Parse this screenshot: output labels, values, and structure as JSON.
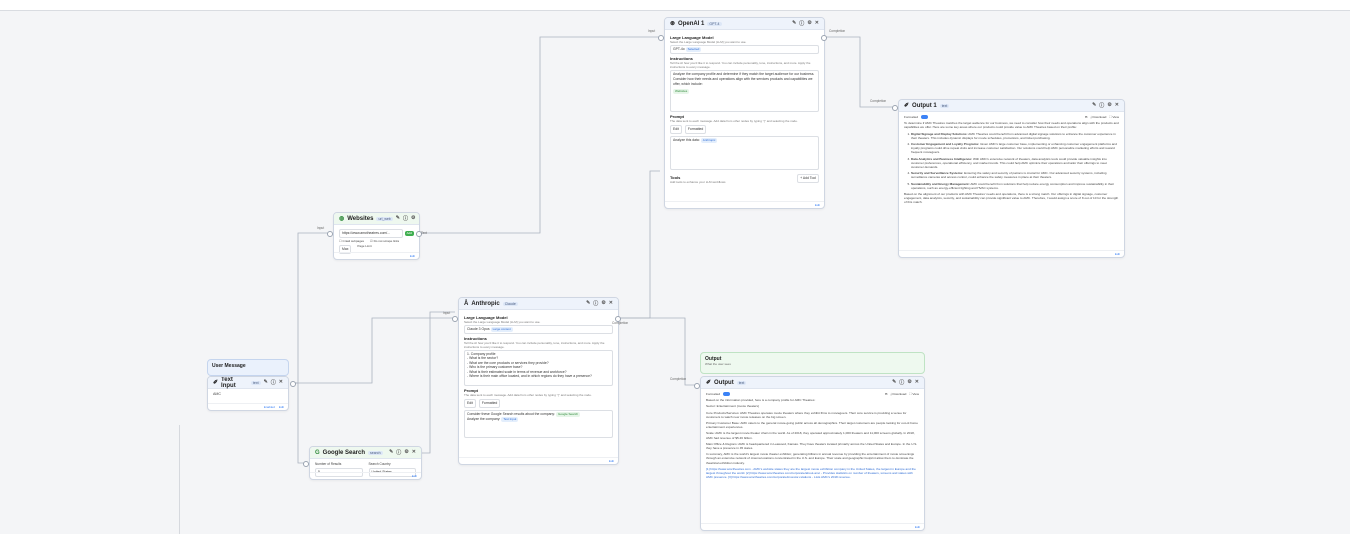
{
  "openai": {
    "title": "OpenAI 1",
    "badge": "GPT-4",
    "llm_label": "Large Language Model",
    "llm_sub": "Select the Large Language Model (LLM) you want to use.",
    "model": "GPT-4o",
    "model_chip": "Selected",
    "instr_label": "Instructions",
    "instr_sub": "Tell the AI how you'd like it to respond. You can include personality, tone, instructions, and more. Apply the instructions to every message.",
    "instr_text": "Analyze the company profile and determine if they match the target audience for our business. Consider how their needs and operations align with the services products and capabilities we offer, which include:",
    "instr_chip": "Websites",
    "prompt_label": "Prompt",
    "prompt_sub": "The data sent to each message. Add data from other nodes by typing \"{\" and selecting the node.",
    "prompt_tabs": [
      "Edit",
      "Formatted"
    ],
    "prompt_text": "Analyze this data:",
    "prompt_chip": "Anthropic",
    "tools_label": "Tools",
    "tools_sub": "Add tools to enhance your LLM workflows",
    "add_tool": "+ Add Tool",
    "footer_left": "",
    "footer_right": "Edit",
    "in_label": "Input",
    "out_label": "Completion"
  },
  "output1": {
    "title": "Output 1",
    "badge": "text",
    "formatted": "Formatted",
    "download": "Download",
    "view": "View",
    "intro": "To determine if AMC Theatres matches the target audience for our business, we need to consider how their needs and operations align with the products and capabilities we offer. Here are some key areas where our products could provide value to AMC Theatres based on their profile:",
    "items": [
      {
        "head": "Digital Signage and Display Solutions:",
        "text": "AMC Theatres could benefit from advanced digital signage solutions to enhance the customer experience in their theaters. This includes dynamic displays for movie schedules, promotions, and ticket purchasing."
      },
      {
        "head": "Customer Engagement and Loyalty Programs:",
        "text": "Given AMC's large customer base, implementing or enhancing customer engagement platforms and loyalty programs could drive repeat visits and increase customer satisfaction. Our solutions could help AMC personalize marketing efforts and reward frequent moviegoers."
      },
      {
        "head": "Data Analytics and Business Intelligence:",
        "text": "With AMC's extensive network of theaters, data analytics tools could provide valuable insights into customer preferences, operational efficiency, and market trends. This could help AMC optimize their operations and tailor their offerings to meet customer demands."
      },
      {
        "head": "Security and Surveillance Systems:",
        "text": "Ensuring the safety and security of patrons is crucial for AMC. Our advanced security systems, including surveillance cameras and access control, could enhance the safety measures in place at their theaters."
      },
      {
        "head": "Sustainability and Energy Management:",
        "text": "AMC could benefit from solutions that help reduce energy consumption and improve sustainability in their operations, such as energy-efficient lighting and HVAC systems."
      }
    ],
    "outro": "Based on the alignment of our products with AMC Theatres' needs and operations, there is a strong match. Our offerings in digital signage, customer engagement, data analytics, security, and sustainability can provide significant value to AMC. Therefore, I would assign a score of 8 out of 10 for the strength of this match.",
    "footer_left": "",
    "footer_right": "Edit",
    "in_label": "Completion"
  },
  "websites": {
    "title": "Websites",
    "badge": "url_web",
    "url": "https://www.amctheatres.com/...",
    "add": "Add",
    "opt1": "Crawl subpages",
    "opt2": "Do not scrape links",
    "row_label": "Max",
    "row_value": "Page Limit",
    "footer_left": "",
    "footer_right": "Edit",
    "in_label": "Input",
    "out_label": "Text"
  },
  "anthropic": {
    "title": "Anthropic",
    "badge": "Claude",
    "llm_label": "Large Language Model",
    "llm_sub": "Select the Large Language Model (LLM) you want to use.",
    "model": "Claude 3 Opus",
    "model_chip": "Large context",
    "instr_label": "Instructions",
    "instr_sub": "Tell the AI how you'd like it to respond. You can include personality, tone, instructions, and more. Apply the instructions to every message.",
    "instr_lines": [
      "1. Company profile",
      "- What is the sector?",
      "- What are the core products or services they provide?",
      "- Who is the primary customer base?",
      "- What is their estimated scale in terms of revenue and workforce?",
      "- Where is their main office located, and in which regions do they have a presence?"
    ],
    "prompt_label": "Prompt",
    "prompt_sub": "The data sent to each message. Add data from other nodes by typing \"{\" and selecting the node.",
    "prompt_tabs": [
      "Edit",
      "Formatted"
    ],
    "prompt_line1": "Consider these Google Search results about the company:",
    "prompt_chip1": "Google Search",
    "prompt_line2": "Analyze the company:",
    "prompt_chip2": "Text Input",
    "footer_left": "",
    "footer_right": "Edit",
    "in_label": "Input",
    "out_label": "Completion"
  },
  "user_message": {
    "title": "User Message"
  },
  "text_input": {
    "title": "Text Input",
    "badge": "text",
    "value": "AMC",
    "footer_left": "Enabled",
    "footer_right": "Edit"
  },
  "google": {
    "title": "Google Search",
    "badge": "search",
    "col1": "Number of Results",
    "col2": "Search Country",
    "val1": "5",
    "val2": "United States",
    "footer_right": "Edit"
  },
  "output_group": {
    "title": "Output",
    "sub": "What the user sees"
  },
  "output2": {
    "title": "Output",
    "badge": "text",
    "formatted": "Formatted",
    "download": "Download",
    "view": "View",
    "paras": [
      "Based on the information provided, here is a company profile for AMC Theatres:",
      "Sector: Entertainment (movie theaters)",
      "Core Products/Services: AMC Theatres operates movie theaters where they exhibit films to moviegoers. Their core service is providing a venue for customers to watch new movie releases on the big screen.",
      "Primary Customer Base: AMC caters to the general movie-going public across all demographics. Their target customers are people looking for out-of-home entertainment experiences.",
      "Scale: AMC is the largest movie theater chain in the world. As of 2018, they operated approximately 1,000 theaters and 11,000 screens globally. In 2018, AMC had revenue of $5.46 billion.",
      "Main Office & Regions: AMC is headquartered in Leawood, Kansas. They have theaters located primarily across the United States and Europe. In the U.S. they have a presence in 45 states.",
      "In summary, AMC is the world's largest movie theater exhibitor, generating billions in annual revenue by providing the entertainment of movie screenings through an extensive network of cinema locations concentrated in the U.S. and Europe. Their scale and geographic footprint allow them to dominate the theatrical exhibition industry.",
      "[1] https://www.amctheatres.com - AMC's website states they are the largest movie exhibition company in the United States, the largest in Europe and the largest throughout the world. [2] https://www.amctheatres.com/corporate/about-amc - Provides statistics on number of theaters, screens and states with AMC presence. [3] https://www.amctheatres.com/corporate/investor-relations - Lists AMC's 2018 revenue."
    ],
    "footer_right": "Edit",
    "in_label": "Completion"
  },
  "port_labels": {
    "text": "Text",
    "input": "Input"
  }
}
